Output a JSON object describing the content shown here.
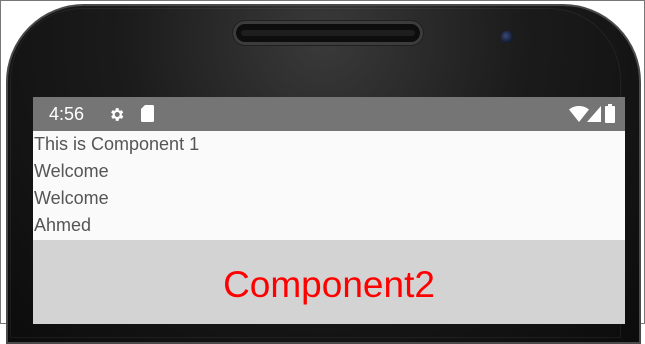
{
  "status_bar": {
    "time": "4:56",
    "background": "#757575",
    "icons": [
      "settings-gear-icon",
      "sd-card-icon",
      "wifi-icon",
      "cell-signal-icon",
      "battery-icon"
    ]
  },
  "component1": {
    "lines": [
      "This is Component 1",
      "Welcome",
      "Welcome",
      "Ahmed"
    ],
    "text_color": "#555555"
  },
  "component2": {
    "text": "Component2",
    "background": "#d3d3d3",
    "text_color": "#ff0000"
  }
}
